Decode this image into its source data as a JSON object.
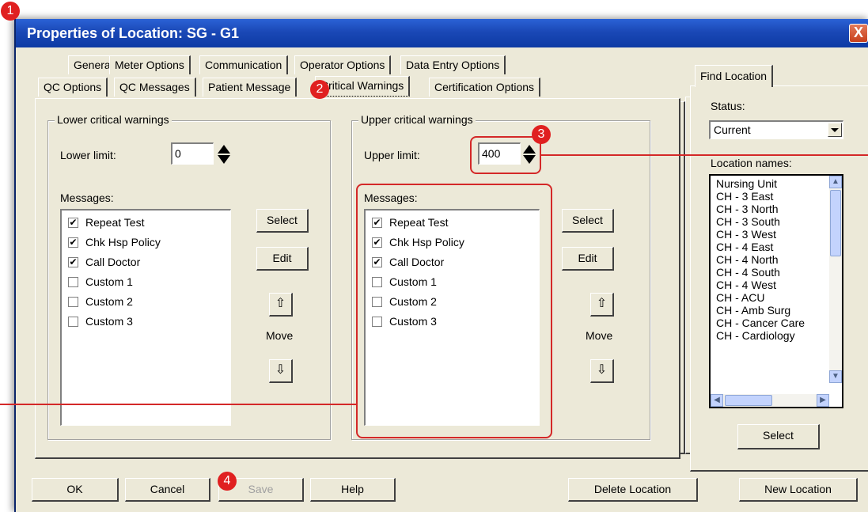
{
  "window": {
    "title": "Properties of Location:  SG - G1",
    "close_glyph": "X"
  },
  "tabs_row1": [
    "General",
    "Meter Options",
    "Communication",
    "Operator Options",
    "Data Entry Options"
  ],
  "tabs_row2": [
    "QC Options",
    "QC Messages",
    "Patient Message",
    "Critical Warnings",
    "Certification Options"
  ],
  "active_tab": "Critical Warnings",
  "lower": {
    "legend": "Lower critical warnings",
    "limit_label": "Lower limit:",
    "limit_value": "0",
    "messages_label": "Messages:",
    "select_label": "Select",
    "edit_label": "Edit",
    "move_label": "Move",
    "items": [
      {
        "label": "Repeat Test",
        "checked": true
      },
      {
        "label": "Chk Hsp Policy",
        "checked": true
      },
      {
        "label": "Call Doctor",
        "checked": true
      },
      {
        "label": "Custom 1",
        "checked": false
      },
      {
        "label": "Custom 2",
        "checked": false
      },
      {
        "label": "Custom 3",
        "checked": false
      }
    ]
  },
  "upper": {
    "legend": "Upper critical warnings",
    "limit_label": "Upper limit:",
    "limit_value": "400",
    "messages_label": "Messages:",
    "select_label": "Select",
    "edit_label": "Edit",
    "move_label": "Move",
    "items": [
      {
        "label": "Repeat Test",
        "checked": true
      },
      {
        "label": "Chk Hsp Policy",
        "checked": true
      },
      {
        "label": "Call Doctor",
        "checked": true
      },
      {
        "label": "Custom 1",
        "checked": false
      },
      {
        "label": "Custom 2",
        "checked": false
      },
      {
        "label": "Custom 3",
        "checked": false
      }
    ]
  },
  "find": {
    "tab_label": "Find Location",
    "status_label": "Status:",
    "status_value": "Current",
    "names_label": "Location names:",
    "names": [
      "Nursing Unit",
      "CH - 3 East",
      "CH - 3 North",
      "CH - 3 South",
      "CH - 3 West",
      "CH - 4 East",
      "CH - 4 North",
      "CH - 4 South",
      "CH - 4 West",
      "CH - ACU",
      "CH - Amb Surg",
      "CH - Cancer Care",
      "CH - Cardiology"
    ],
    "select_label": "Select"
  },
  "footer": {
    "ok": "OK",
    "cancel": "Cancel",
    "save": "Save",
    "help": "Help",
    "delete": "Delete Location",
    "new": "New Location"
  },
  "callouts": [
    "1",
    "2",
    "3",
    "4"
  ],
  "colors": {
    "titlebar": "#1a48b6",
    "dialog_bg": "#ece9d8",
    "callout_red": "#e02020"
  }
}
